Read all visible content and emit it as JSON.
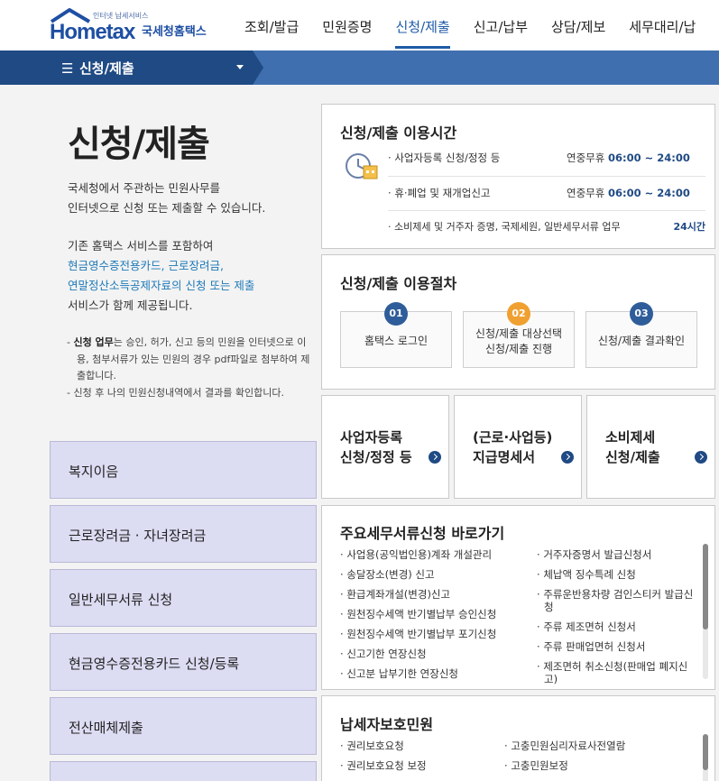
{
  "header": {
    "logo_tagline": "인터넷 납세서비스",
    "logo_text": "Hometax",
    "logo_ko": "국세청홈택스",
    "nav": [
      "조회/발급",
      "민원증명",
      "신청/제출",
      "신고/납부",
      "상담/제보",
      "세무대리/납"
    ],
    "active_nav": "신청/제출"
  },
  "bar": {
    "menu_label": "신청/제출"
  },
  "left": {
    "title": "신청/제출",
    "intro_1": "국세청에서 주관하는 민원사무를",
    "intro_2": "인터넷으로 신청 또는 제출할 수 있습니다.",
    "intro_3": "기존 홈택스 서비스를 포함하여",
    "intro_hl_1": "현금영수증전용카드, 근로장려금,",
    "intro_hl_2": "연말정산소득공제자료의 신청 또는 제출",
    "intro_4": "서비스가 함께 제공됩니다.",
    "note_1_bold": "신청 업무",
    "note_1": "는 승인, 허가, 신고 등의 민원을 인터넷으로 이용, 첨부서류가 있는 민원의 경우 pdf파일로 첨부하여 제출합니다.",
    "note_2": "신청 후 나의 민원신청내역에서 결과를 확인합니다.",
    "menu": [
      "복지이음",
      "근로장려금 · 자녀장려금",
      "일반세무서류 신청",
      "현금영수증전용카드 신청/등록",
      "전산매체제출",
      ""
    ]
  },
  "hours": {
    "title": "신청/제출 이용시간",
    "rows": [
      {
        "label": "사업자등록 신청/정정 등",
        "pre": "연중무휴 ",
        "time": "06:00 ~ 24:00"
      },
      {
        "label": "휴·폐업 및 재개업신고",
        "pre": "연중무휴 ",
        "time": "06:00 ~ 24:00"
      },
      {
        "label": "소비제세 및 거주자 증명, 국제세원, 일반세무서류 업무",
        "pre": "",
        "time": "24시간"
      }
    ]
  },
  "procedure": {
    "title": "신청/제출 이용절차",
    "steps": [
      {
        "num": "01",
        "line1": "홈택스 로그인",
        "line2": ""
      },
      {
        "num": "02",
        "line1": "신청/제출 대상선택",
        "line2": "신청/제출 진행"
      },
      {
        "num": "03",
        "line1": "신청/제출 결과확인",
        "line2": ""
      }
    ]
  },
  "tiles": [
    {
      "line1": "사업자등록",
      "line2": "신청/정정 등"
    },
    {
      "line1": "(근로·사업등)",
      "line2": "지급명세서"
    },
    {
      "line1": "소비제세",
      "line2": "신청/제출"
    }
  ],
  "shortcuts": {
    "title": "주요세무서류신청 바로가기",
    "left": [
      "사업용(공익법인용)계좌 개설관리",
      "송달장소(변경) 신고",
      "환급계좌개설(변경)신고",
      "원천징수세액 반기별납부 승인신청",
      "원천징수세액 반기별납부 포기신청",
      "신고기한 연장신청",
      "신고분 납부기한 연장신청"
    ],
    "right": [
      "거주자증명서 발급신청서",
      "체납액 징수특례 신청",
      "주류운반용차량 검인스티커 발급신청",
      "주류 제조면허 신청서",
      "주류 판매업면허 신청서",
      "제조면허 취소신청(판매업 폐지신고)"
    ]
  },
  "protect": {
    "title": "납세자보호민원",
    "left": [
      "권리보호요청",
      "권리보호요청 보정"
    ],
    "right": [
      "고충민원심리자료사전열람",
      "고충민원보정"
    ]
  },
  "colors": {
    "navy": "#1f4a84",
    "bar_blue": "#3f6faf",
    "step_orange": "#f0a030",
    "nav_bg": "#dcdcf3"
  }
}
